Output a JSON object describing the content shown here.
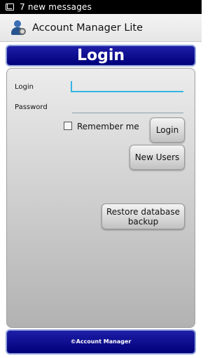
{
  "status_bar": {
    "notification_text": "7 new messages",
    "icon": "message-notification-icon"
  },
  "action_bar": {
    "title": "Account Manager Lite",
    "icon": "account-manager-app-icon"
  },
  "header": {
    "title": "Login"
  },
  "form": {
    "login_label": "Login",
    "login_value": "",
    "password_label": "Password",
    "password_value": "",
    "remember_label": "Remember me",
    "remember_checked": false
  },
  "buttons": {
    "login": "Login",
    "new_users": "New Users",
    "restore": "Restore database backup"
  },
  "footer": {
    "text": "©Account Manager"
  },
  "colors": {
    "accent_blue": "#00007a",
    "input_focus": "#33b5e5",
    "panel_gray": "#cfcfcf"
  }
}
